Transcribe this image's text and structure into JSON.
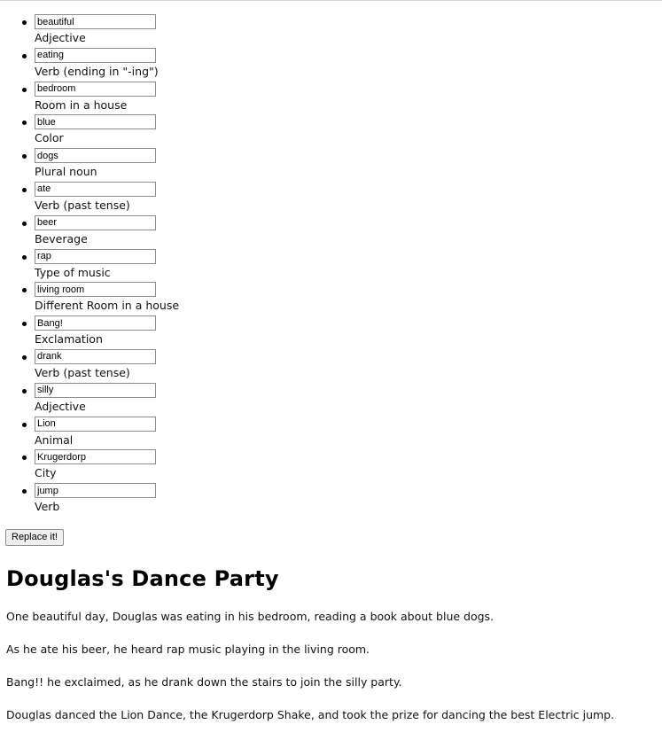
{
  "fields": [
    {
      "value": "beautiful",
      "label": "Adjective"
    },
    {
      "value": "eating",
      "label": "Verb (ending in \"-ing\")"
    },
    {
      "value": "bedroom",
      "label": "Room in a house"
    },
    {
      "value": "blue",
      "label": "Color"
    },
    {
      "value": "dogs",
      "label": "Plural noun"
    },
    {
      "value": "ate",
      "label": "Verb (past tense)"
    },
    {
      "value": "beer",
      "label": "Beverage"
    },
    {
      "value": "rap",
      "label": "Type of music"
    },
    {
      "value": "living room",
      "label": "Different Room in a house"
    },
    {
      "value": "Bang!",
      "label": "Exclamation"
    },
    {
      "value": "drank",
      "label": "Verb (past tense)"
    },
    {
      "value": "silly",
      "label": "Adjective"
    },
    {
      "value": "Lion",
      "label": "Animal"
    },
    {
      "value": "Krugerdorp",
      "label": "City"
    },
    {
      "value": "jump",
      "label": "Verb"
    }
  ],
  "replace_button": {
    "label": "Replace it!"
  },
  "story": {
    "title": "Douglas's Dance Party",
    "paragraphs": [
      "One beautiful day, Douglas was eating in his bedroom, reading a book about blue dogs.",
      "As he ate his beer, he heard rap music playing in the living room.",
      "Bang!! he exclaimed, as he drank down the stairs to join the silly party.",
      "Douglas danced the Lion Dance, the Krugerdorp Shake, and took the prize for dancing the best Electric jump."
    ]
  }
}
